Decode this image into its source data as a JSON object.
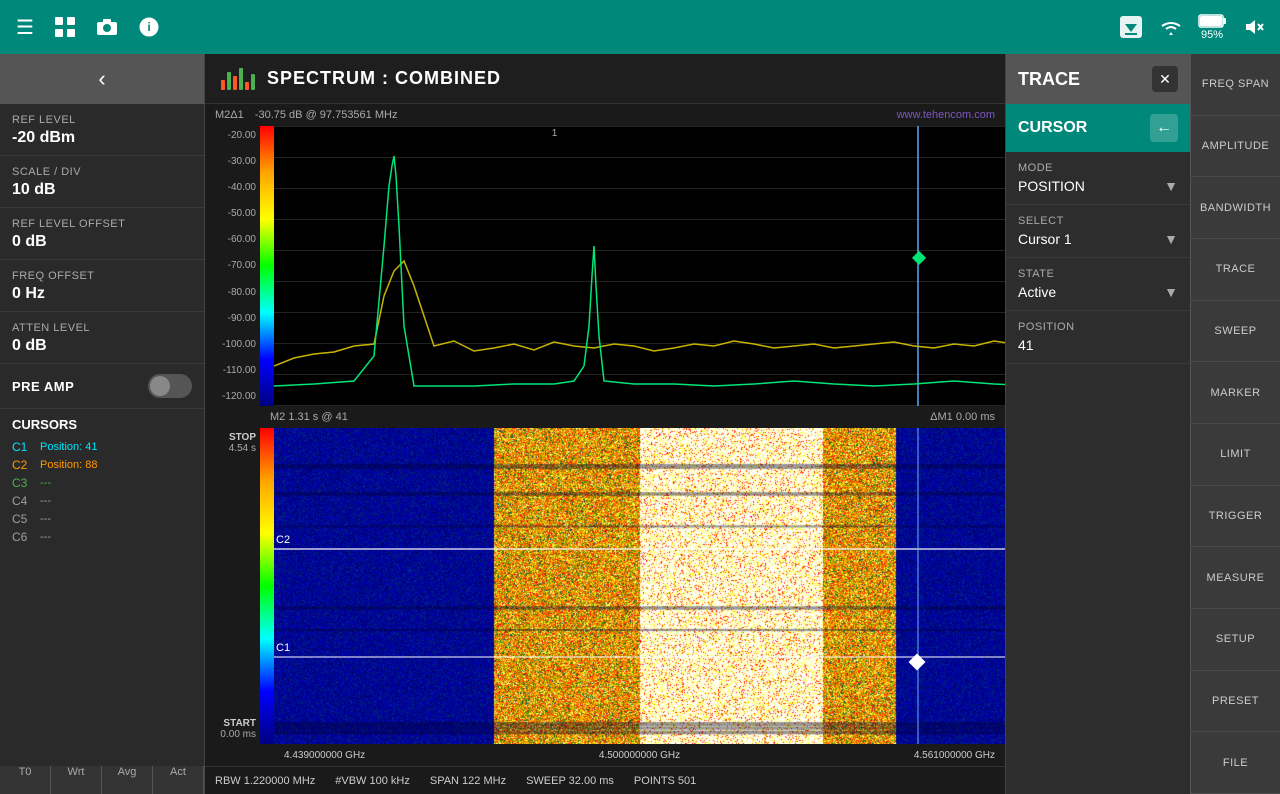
{
  "topbar": {
    "menu_icon": "☰",
    "grid_icon": "⊞",
    "camera_icon": "📷",
    "info_icon": "ℹ",
    "save_icon": "⬇",
    "wifi_icon": "▼",
    "battery_pct": "95%",
    "mute_icon": "🔇"
  },
  "left_panel": {
    "back_icon": "‹",
    "items": [
      {
        "label": "REF LEVEL",
        "value": "-20 dBm"
      },
      {
        "label": "SCALE / DIV",
        "value": "10 dB"
      },
      {
        "label": "REF LEVEL OFFSET",
        "value": "0 dB"
      },
      {
        "label": "FREQ OFFSET",
        "value": "0 Hz"
      },
      {
        "label": "ATTEN LEVEL",
        "value": "0 dB"
      }
    ],
    "pre_amp_label": "PRE AMP",
    "cursors_title": "CURSORS",
    "cursors": [
      {
        "id": "C1",
        "val": "Position: 41",
        "color": "c1-color"
      },
      {
        "id": "C2",
        "val": "Position: 88",
        "color": "c2-color"
      },
      {
        "id": "C3",
        "val": "---",
        "color": "c3-color"
      },
      {
        "id": "C4",
        "val": "---",
        "color": "c4-color"
      },
      {
        "id": "C5",
        "val": "---",
        "color": "c5-color"
      },
      {
        "id": "C6",
        "val": "---",
        "color": "c6-color"
      }
    ],
    "bottom_tabs": [
      "T0",
      "Wrt",
      "Avg",
      "Act"
    ]
  },
  "center_header": {
    "title": "SPECTRUM : COMBINED"
  },
  "spectrum": {
    "marker_label": "M2Δ1",
    "marker_value": "-30.75 dB @ 97.753561 MHz",
    "watermark": "www.tehencom.com",
    "y_axis": [
      "-20.00",
      "-30.00",
      "-40.00",
      "-50.00",
      "-60.00",
      "-70.00",
      "-80.00",
      "-90.00",
      "-100.00",
      "-110.00",
      "-120.00"
    ],
    "status_m2": "M2  1.31 s @ 41",
    "status_delta": "ΔM1  0.00 ms",
    "stop_label": "STOP",
    "stop_value": "4.54 s",
    "wf_labels": [
      "C2",
      "C1"
    ],
    "start_label": "START",
    "start_value": "0.00 ms",
    "freq_labels": [
      "4.439000000 GHz",
      "4.500000000 GHz",
      "4.561000000 GHz"
    ],
    "bottom_info": [
      "RBW  1.220000 MHz",
      "#VBW  100 kHz",
      "SPAN  122 MHz",
      "SWEEP    32.00 ms",
      "POINTS  501"
    ]
  },
  "trace_panel": {
    "title": "TRACE",
    "close_icon": "✕",
    "back_icon": "←",
    "cursor_label": "CURSOR",
    "sections": [
      {
        "label": "MODE",
        "value": "POSITION"
      },
      {
        "label": "SELECT",
        "value": "Cursor 1"
      },
      {
        "label": "STATE",
        "value": "Active"
      },
      {
        "label": "POSITION",
        "value": "41"
      }
    ]
  },
  "side_nav": {
    "items": [
      "FREQ SPAN",
      "AMPLITUDE",
      "BANDWIDTH",
      "TRACE",
      "SWEEP",
      "MARKER",
      "LIMIT",
      "TRIGGER",
      "MEASURE",
      "SETUP",
      "PRESET",
      "FILE"
    ]
  }
}
